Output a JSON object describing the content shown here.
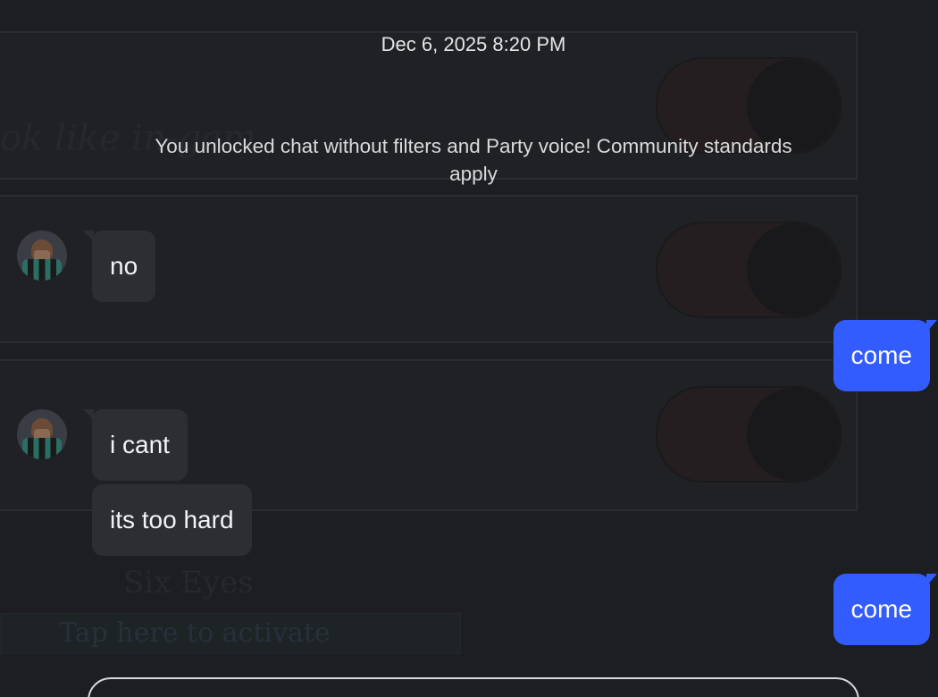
{
  "chat": {
    "timestamp": "Dec 6, 2025 8:20 PM",
    "system_notice": "You unlocked chat without filters and Party voice! Community standards apply",
    "messages": [
      {
        "direction": "incoming",
        "text": "no"
      },
      {
        "direction": "outgoing",
        "text": "come"
      },
      {
        "direction": "incoming",
        "text": "i cant"
      },
      {
        "direction": "incoming",
        "text": "its too hard"
      },
      {
        "direction": "outgoing",
        "text": "come"
      }
    ]
  },
  "background": {
    "ghost_heading": "ok like in-gam",
    "ghost_label": "Six Eyes",
    "ghost_button": "Tap here to activate"
  },
  "colors": {
    "background": "#1c1e22",
    "incoming_bubble": "#2c2e33",
    "outgoing_bubble": "#335cff",
    "text": "#f2f3f5"
  }
}
